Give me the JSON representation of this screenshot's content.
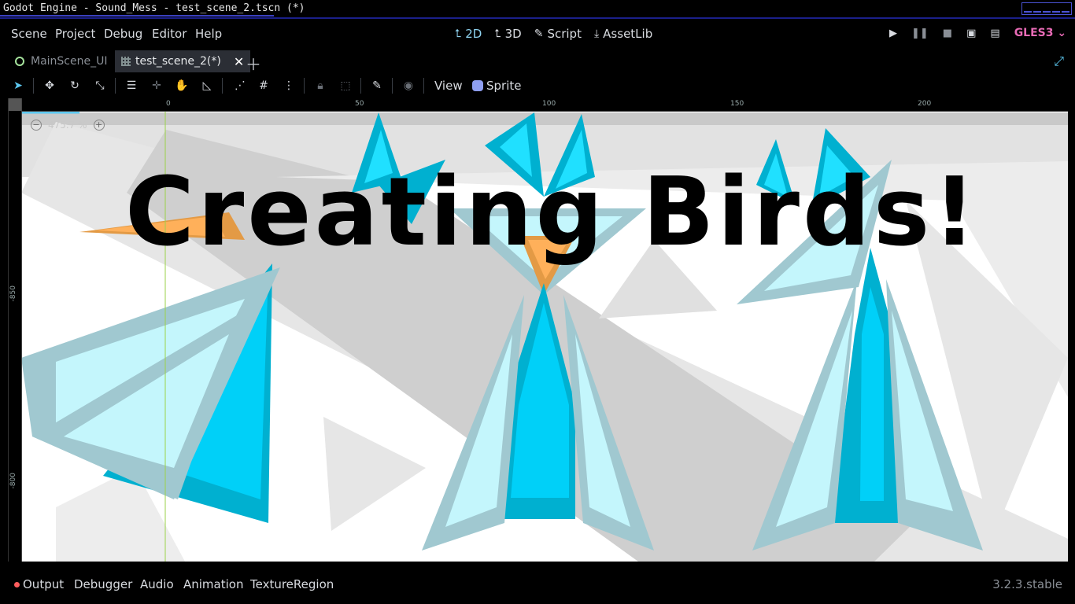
{
  "window": {
    "title": "Godot Engine - Sound_Mess - test_scene_2.tscn (*)"
  },
  "menu": [
    "Scene",
    "Project",
    "Debug",
    "Editor",
    "Help"
  ],
  "workspaces": [
    {
      "label": "2D",
      "icon": "2d-icon",
      "active": true
    },
    {
      "label": "3D",
      "icon": "3d-icon",
      "active": false
    },
    {
      "label": "Script",
      "icon": "script-icon",
      "active": false
    },
    {
      "label": "AssetLib",
      "icon": "assetlib-icon",
      "active": false
    }
  ],
  "renderer": "GLES3",
  "scene_tabs": [
    {
      "label": "MainScene_UI",
      "active": false
    },
    {
      "label": "test_scene_2(*)",
      "active": true
    }
  ],
  "toolbar": {
    "view_label": "View",
    "sprite_label": "Sprite"
  },
  "ruler": {
    "top": [
      "0",
      "50",
      "100",
      "150",
      "200"
    ],
    "left": [
      "-850",
      "-800"
    ]
  },
  "viewport": {
    "zoom": "475.7 %",
    "overlay_text": "Creating Birds!"
  },
  "bottom_tabs": [
    "Output",
    "Debugger",
    "Audio",
    "Animation",
    "TextureRegion"
  ],
  "version": "3.2.3.stable",
  "colors": {
    "accent": "#5cc8f0",
    "gles": "#e96bb6",
    "bird_cyan": "#00c8f0",
    "bird_light": "#c4f6fc",
    "bird_border": "#9fc7cf",
    "beak": "#f0a050"
  }
}
